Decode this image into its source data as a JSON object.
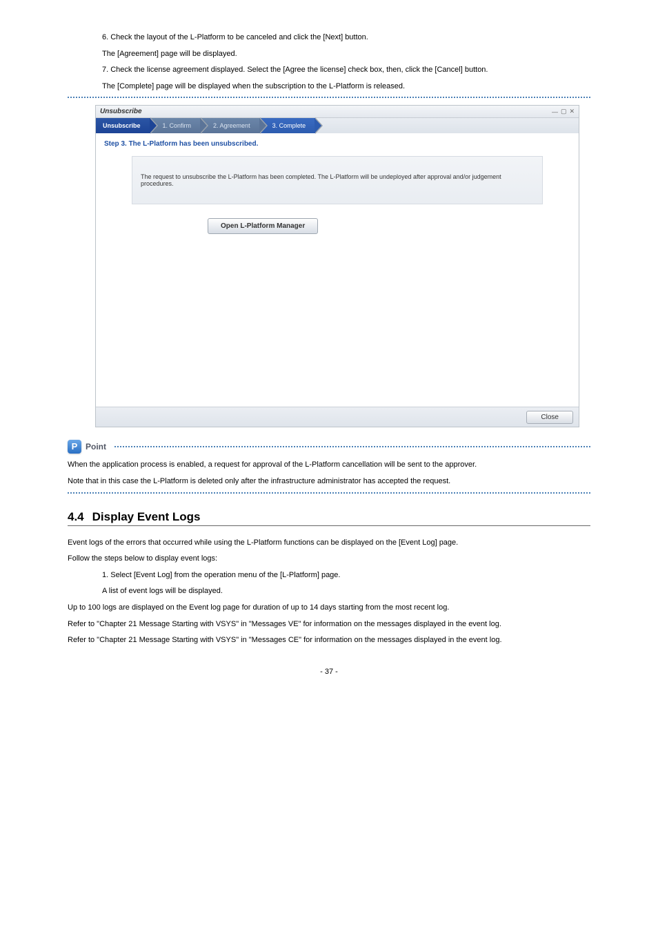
{
  "intro": {
    "line1": "6. Check the layout of the L-Platform to be canceled and click the [Next] button.",
    "line1b": "The [Agreement] page will be displayed.",
    "line2": "7. Check the license agreement displayed. Select the [Agree the license] check box, then, click the [Cancel] button.",
    "line2b": "The [Complete] page will be displayed when the subscription to the L-Platform is released."
  },
  "screenshot": {
    "win_title": "Unsubscribe",
    "steps": {
      "s0": "Unsubscribe",
      "s1": "1. Confirm",
      "s2": "2. Agreement",
      "s3": "3. Complete"
    },
    "step_heading": "Step 3. The L-Platform has been unsubscribed.",
    "message": "The request to unsubscribe the L-Platform has been completed. The L-Platform will be undeployed after approval and/or judgement procedures.",
    "open_btn": "Open L-Platform Manager",
    "close_btn": "Close"
  },
  "point": {
    "label": "Point",
    "icon_glyph": "P",
    "text1": "When the application process is enabled, a request for approval of the L-Platform cancellation will be sent to the approver.",
    "text2": "Note that in this case the L-Platform is deleted only after the infrastructure administrator has accepted the request."
  },
  "section": {
    "num": "4.4",
    "name": "Display Event Logs"
  },
  "event": {
    "p1": "Event logs of the errors that occurred while using the L-Platform functions can be displayed on the [Event Log] page.",
    "p2": "Follow the steps below to display event logs:",
    "step1": "1. Select [Event Log] from the operation menu of the [L-Platform] page.",
    "step1b": "A list of event logs will be displayed.",
    "p3": "Up to 100 logs are displayed on the Event log page for duration of up to 14 days starting from the most recent log.",
    "p4a": "Refer to \"Chapter 21 Message Starting with VSYS\" in \"Messages VE\" for information on the messages displayed in the event log.",
    "p4b": "Refer to \"Chapter 21 Message Starting with VSYS\" in \"Messages CE\" for information on the messages displayed in the event log."
  },
  "page_number": "- 37 -"
}
